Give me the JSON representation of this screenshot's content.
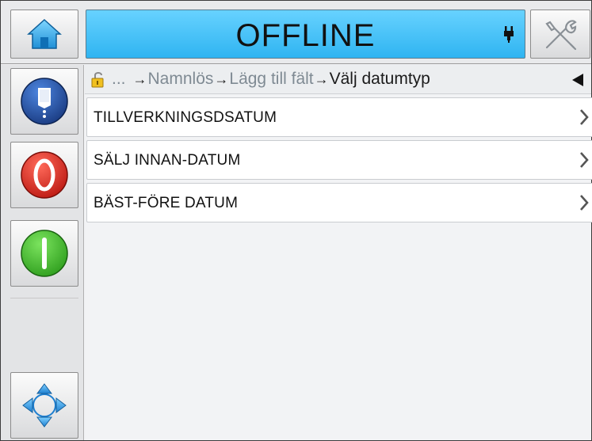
{
  "header": {
    "status": "OFFLINE",
    "home_icon": "home-icon",
    "tools_icon": "tools-icon",
    "status_icon": "printhead-icon"
  },
  "sidebar": {
    "items": [
      {
        "icon": "ink-icon",
        "color": "#1f4fa8"
      },
      {
        "icon": "stop-icon",
        "color": "#d8261d"
      },
      {
        "icon": "start-icon",
        "color": "#3fbf2b"
      },
      {
        "icon": "navigate-icon",
        "color": "#2f8fd8"
      }
    ]
  },
  "breadcrumb": {
    "ellipsis": "...",
    "arrow": "→",
    "items": [
      "Namnlös",
      "Lägg till fält"
    ],
    "current": "Välj datumtyp"
  },
  "menu": {
    "items": [
      {
        "label": "TILLVERKNINGSDSATUM"
      },
      {
        "label": "SÄLJ INNAN-DATUM"
      },
      {
        "label": "BÄST-FÖRE DATUM"
      }
    ]
  }
}
